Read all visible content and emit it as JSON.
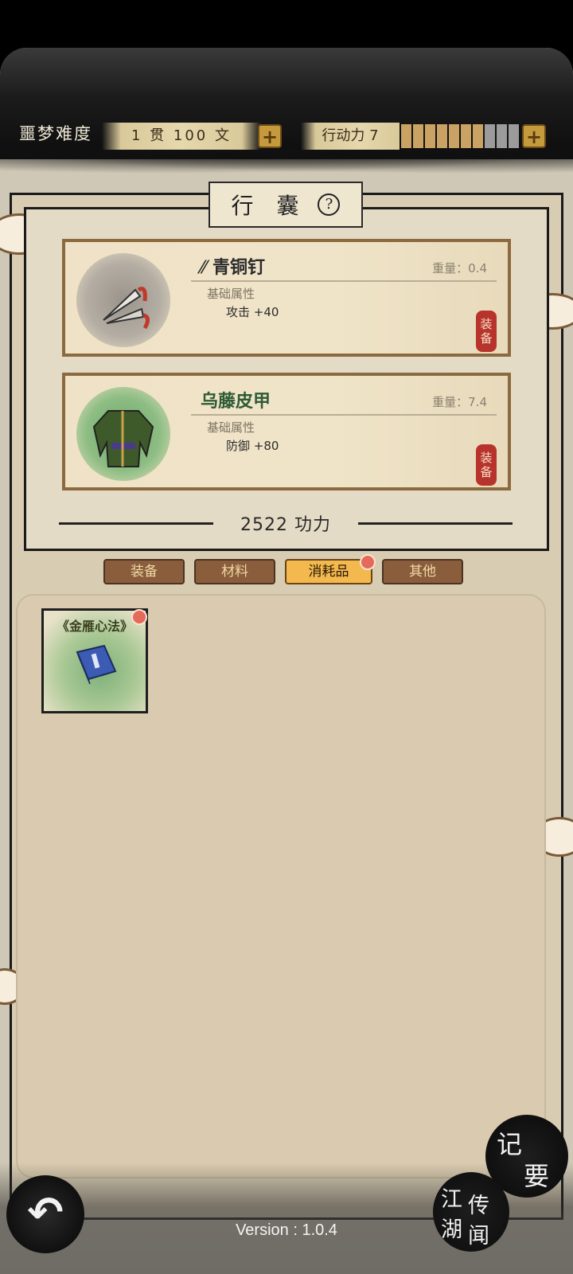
{
  "header": {
    "difficulty": "噩梦难度",
    "money": "1 贯 100 文",
    "stamina_label": "行动力 7",
    "stamina_filled": 7,
    "stamina_total": 10
  },
  "bag": {
    "title": "行 囊",
    "help": "?",
    "items": [
      {
        "name": "青铜钉",
        "weight": "重量：0.4",
        "basic": "基础属性",
        "stat": "攻击 +40",
        "stamp_top": "装",
        "stamp_bottom": "备",
        "icon": "bronze-dart-icon"
      },
      {
        "name": "乌藤皮甲",
        "weight": "重量：7.4",
        "basic": "基础属性",
        "stat": "防御 +80",
        "stamp_top": "装",
        "stamp_bottom": "备",
        "icon": "rattan-armor-icon"
      }
    ],
    "power": "2522 功力"
  },
  "tabs": [
    {
      "label": "装备",
      "active": false
    },
    {
      "label": "材料",
      "active": false
    },
    {
      "label": "消耗品",
      "active": true
    },
    {
      "label": "其他",
      "active": false
    }
  ],
  "inventory": {
    "items": [
      {
        "label": "《金雁心法》",
        "icon": "blue-book-icon"
      }
    ]
  },
  "bottom": {
    "back_icon": "back-arrow-icon",
    "notes": [
      "记",
      "要"
    ],
    "rumors": [
      "江",
      "湖",
      "传",
      "闻"
    ],
    "version": "Version : 1.0.4"
  },
  "colors": {
    "gold": "#c59a3c",
    "stamp_red": "#b8332c",
    "active_tab": "#f3b84e",
    "tab": "#8a5e3c"
  }
}
